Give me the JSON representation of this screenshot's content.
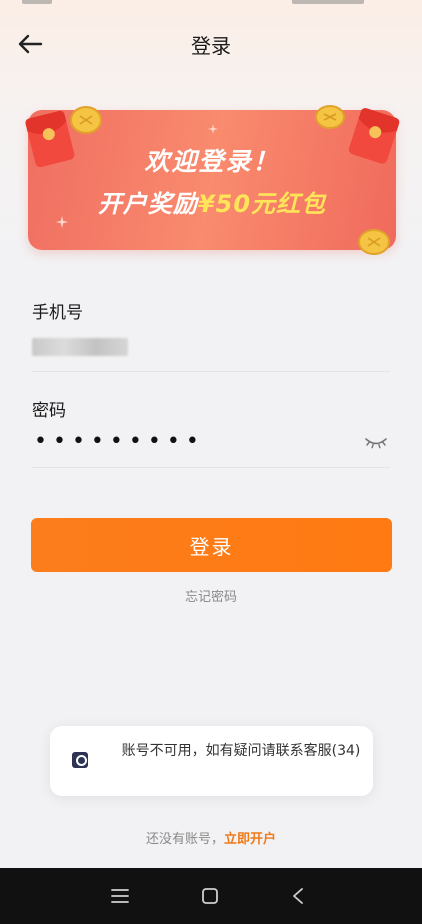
{
  "header": {
    "title": "登录",
    "back_icon": "arrow-left-icon"
  },
  "banner": {
    "line1": "欢迎登录！",
    "line2_prefix": "开户奖励",
    "line2_highlight": "¥50元红包"
  },
  "phone": {
    "label": "手机号",
    "value_masked": true
  },
  "password": {
    "label": "密码",
    "value": "•••••••••",
    "toggle_icon": "eye-closed-icon"
  },
  "login_button": {
    "label": "登录"
  },
  "forgot": {
    "label": "忘记密码"
  },
  "toast": {
    "message": "账号不可用，如有疑问请联系客服(34)"
  },
  "signup": {
    "prompt": "还没有账号，",
    "link": "立即开户"
  },
  "colors": {
    "primary": "#FF7A12",
    "banner": "#F06E61",
    "highlight": "#FFE45A",
    "link": "#EE7A1A"
  }
}
